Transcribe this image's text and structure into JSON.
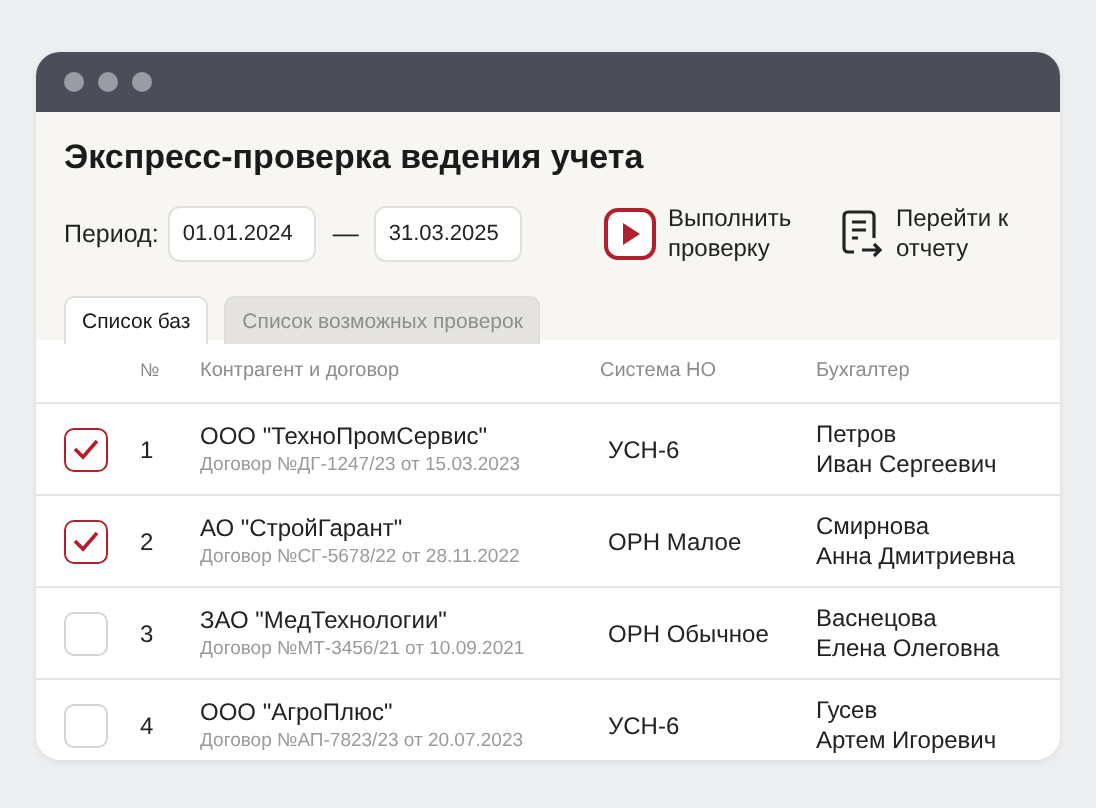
{
  "title": "Экспресс-проверка ведения учета",
  "period": {
    "label": "Период:",
    "from": "01.01.2024",
    "separator": "—",
    "to": "31.03.2025"
  },
  "actions": [
    {
      "kind": "run",
      "label": "Выполнить проверку"
    },
    {
      "kind": "report",
      "label": "Перейти к отчету"
    }
  ],
  "tabs": [
    {
      "label": "Список баз",
      "selected": true
    },
    {
      "label": "Список возможных проверок",
      "selected": false
    }
  ],
  "table": {
    "columns": [
      "№",
      "Контрагент и договор",
      "Система НО",
      "Бухгалтер"
    ],
    "rows": [
      {
        "checked": true,
        "number": "1",
        "company": "ООО \"ТехноПромСервис\"",
        "contract": "Договор №ДГ-1247/23 от 15.03.2023",
        "system": "УСН-6",
        "accountant": [
          "Петров",
          "Иван Сергеевич"
        ]
      },
      {
        "checked": true,
        "number": "2",
        "company": "АО \"СтройГарант\"",
        "contract": "Договор №СГ-5678/22 от 28.11.2022",
        "system": "ОРН Малое",
        "accountant": [
          "Смирнова",
          "Анна Дмитриевна"
        ]
      },
      {
        "checked": false,
        "number": "3",
        "company": "ЗАО \"МедТехнологии\"",
        "contract": "Договор №МТ-3456/21 от 10.09.2021",
        "system": "ОРН Обычное",
        "accountant": [
          "Васнецова",
          "Елена Олеговна"
        ]
      },
      {
        "checked": false,
        "number": "4",
        "company": "ООО \"АгроПлюс\"",
        "contract": "Договор №АП-7823/23 от 20.07.2023",
        "system": "УСН-6",
        "accountant": [
          "Гусев",
          "Артем Игоревич"
        ]
      }
    ]
  }
}
